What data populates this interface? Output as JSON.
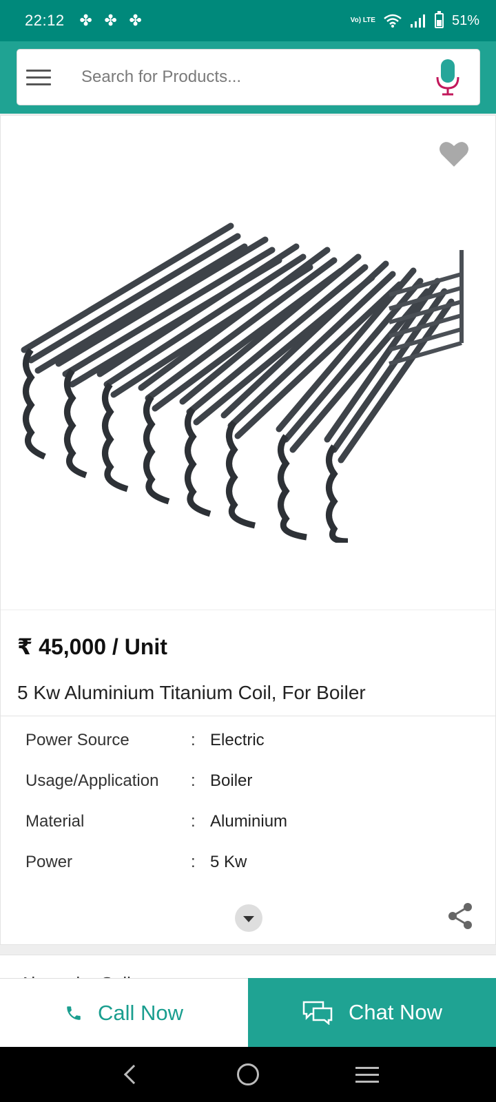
{
  "status_bar": {
    "time": "22:12",
    "battery": "51%",
    "network_badge": "Vo) LTE",
    "icons": [
      "notification-icon",
      "notification-icon",
      "notification-icon",
      "volte-icon",
      "wifi-icon",
      "signal-icon",
      "battery-icon"
    ]
  },
  "search": {
    "placeholder": "Search for Products..."
  },
  "product": {
    "price": "₹ 45,000 / Unit",
    "title": "5 Kw Aluminium Titanium Coil, For Boiler",
    "specs": [
      {
        "key": "Power Source",
        "value": "Electric"
      },
      {
        "key": "Usage/Application",
        "value": "Boiler"
      },
      {
        "key": "Material",
        "value": "Aluminium"
      },
      {
        "key": "Power",
        "value": "5 Kw"
      }
    ]
  },
  "seller": {
    "title": "About the Seller"
  },
  "actions": {
    "call_label": "Call Now",
    "chat_label": "Chat Now"
  },
  "colors": {
    "primary": "#00897b",
    "accent": "#1fa393",
    "mic_red": "#c2185b"
  }
}
